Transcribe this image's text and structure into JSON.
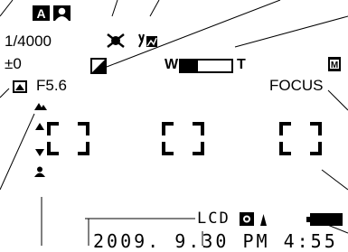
{
  "indicators": {
    "shutter_speed": "1/4000",
    "exposure_comp": "±0",
    "aperture": "F5.6",
    "focus_label": "FOCUS",
    "lcd_label": "LCD",
    "zoom_wide": "W",
    "zoom_tele": "T",
    "zoom_level": 0.35,
    "mode_letter": "A",
    "memory_letter": "M"
  },
  "datetime": {
    "date": "2009. 9.30",
    "time": "PM 4:55"
  },
  "battery": {
    "bars": 3
  },
  "icons": [
    "mode-a-icon",
    "portrait-mode-icon",
    "flash-off-icon",
    "white-balance-icon",
    "exposure-meter-icon",
    "metering-mode-icon",
    "memory-icon",
    "macro-icon",
    "manual-focus-arrows-icon",
    "face-detect-icon",
    "brightness-icon",
    "battery-icon"
  ]
}
